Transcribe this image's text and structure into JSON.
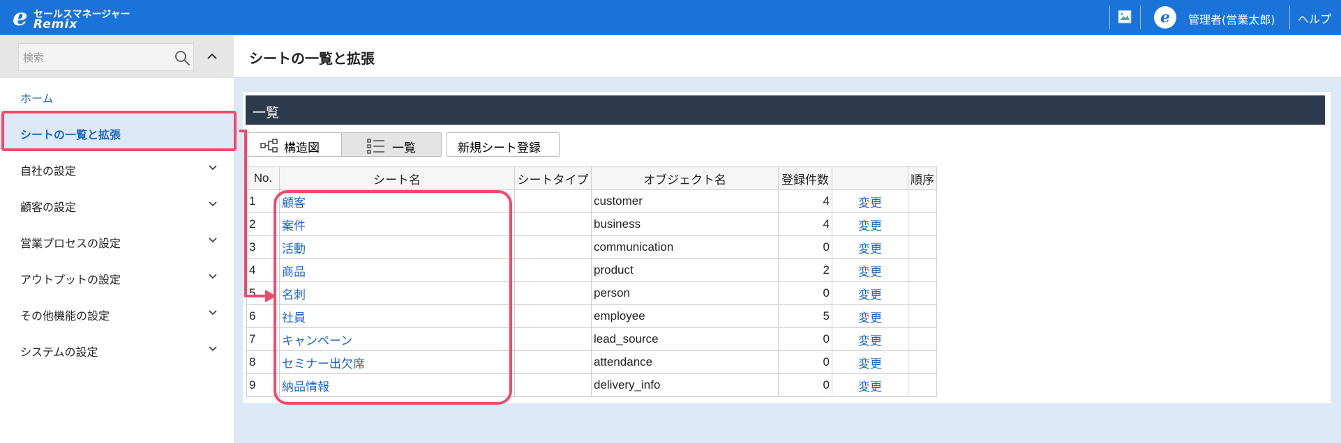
{
  "header": {
    "logo_line1": "セールスマネージャー",
    "logo_line2": "Remix",
    "user_name": "管理者(営業太郎)",
    "help_label": "ヘルプ"
  },
  "sidebar": {
    "search_placeholder": "検索",
    "items": [
      {
        "label": "ホーム",
        "has_chevron": false
      },
      {
        "label": "シートの一覧と拡張",
        "active": true,
        "has_chevron": false
      },
      {
        "label": "自社の設定",
        "has_chevron": true
      },
      {
        "label": "顧客の設定",
        "has_chevron": true
      },
      {
        "label": "営業プロセスの設定",
        "has_chevron": true
      },
      {
        "label": "アウトプットの設定",
        "has_chevron": true
      },
      {
        "label": "その他機能の設定",
        "has_chevron": true
      },
      {
        "label": "システムの設定",
        "has_chevron": true
      }
    ]
  },
  "main": {
    "page_title": "シートの一覧と拡張",
    "panel_title": "一覧",
    "view_buttons": {
      "structure": "構造図",
      "list": "一覧"
    },
    "new_sheet_button": "新規シート登録",
    "table": {
      "headers": [
        "No.",
        "シート名",
        "シートタイプ",
        "オブジェクト名",
        "登録件数",
        "",
        "順序"
      ],
      "rows": [
        {
          "no": "1",
          "name": "顧客",
          "type": "",
          "object": "customer",
          "count": "4",
          "action": "変更"
        },
        {
          "no": "2",
          "name": "案件",
          "type": "",
          "object": "business",
          "count": "4",
          "action": "変更"
        },
        {
          "no": "3",
          "name": "活動",
          "type": "",
          "object": "communication",
          "count": "0",
          "action": "変更"
        },
        {
          "no": "4",
          "name": "商品",
          "type": "",
          "object": "product",
          "count": "2",
          "action": "変更"
        },
        {
          "no": "5",
          "name": "名刺",
          "type": "",
          "object": "person",
          "count": "0",
          "action": "変更"
        },
        {
          "no": "6",
          "name": "社員",
          "type": "",
          "object": "employee",
          "count": "5",
          "action": "変更"
        },
        {
          "no": "7",
          "name": "キャンペーン",
          "type": "",
          "object": "lead_source",
          "count": "0",
          "action": "変更"
        },
        {
          "no": "8",
          "name": "セミナー出欠席",
          "type": "",
          "object": "attendance",
          "count": "0",
          "action": "変更"
        },
        {
          "no": "9",
          "name": "納品情報",
          "type": "",
          "object": "delivery_info",
          "count": "0",
          "action": "変更"
        }
      ]
    }
  },
  "colors": {
    "header_bg": "#1a73d9",
    "panel_head_bg": "#2d3a4d",
    "link": "#1a66c4",
    "highlight": "#f04a6a",
    "content_bg": "#dce9f6"
  }
}
